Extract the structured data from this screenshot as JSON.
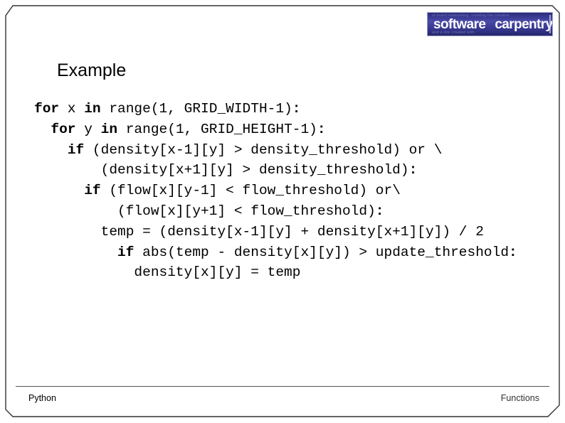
{
  "slide": {
    "title": "Example",
    "logo": {
      "word_1": "software",
      "word_2": "carpentry",
      "ghost_top": "of  insert  networking,   creating  the  creative",
      "ghost_bottom": "and  a  doc  created  with",
      "background_color": "#3a3a93",
      "text_color": "#ffffff"
    },
    "footer": {
      "left": "Python",
      "right": "Functions"
    },
    "frame": {
      "border_color": "#333333"
    }
  },
  "code": {
    "language": "python",
    "lines": [
      [
        {
          "t": "for",
          "b": true
        },
        {
          "t": " x ",
          "b": false
        },
        {
          "t": "in",
          "b": true
        },
        {
          "t": " range(1, GRID_WIDTH-1)",
          "b": false
        },
        {
          "t": ":",
          "b": true
        }
      ],
      [
        {
          "t": "  ",
          "b": false
        },
        {
          "t": "for",
          "b": true
        },
        {
          "t": " y ",
          "b": false
        },
        {
          "t": "in",
          "b": true
        },
        {
          "t": " range(1, GRID_HEIGHT-1)",
          "b": false
        },
        {
          "t": ":",
          "b": true
        }
      ],
      [
        {
          "t": "    ",
          "b": false
        },
        {
          "t": "if",
          "b": true
        },
        {
          "t": " (density[x-1][y] > density_threshold) or \\",
          "b": false
        }
      ],
      [
        {
          "t": "        (density[x+1][y] > density_threshold)",
          "b": false
        },
        {
          "t": ":",
          "b": true
        }
      ],
      [
        {
          "t": "      ",
          "b": false
        },
        {
          "t": "if",
          "b": true
        },
        {
          "t": " (flow[x][y-1] < flow_threshold) or\\",
          "b": false
        }
      ],
      [
        {
          "t": "          (flow[x][y+1] < flow_threshold)",
          "b": false
        },
        {
          "t": ":",
          "b": true
        }
      ],
      [
        {
          "t": "        temp = (density[x-1][y] + density[x+1][y]) / 2",
          "b": false
        }
      ],
      [
        {
          "t": "          ",
          "b": false
        },
        {
          "t": "if",
          "b": true
        },
        {
          "t": " abs(temp - density[x][y]) > update_threshold",
          "b": false
        },
        {
          "t": ":",
          "b": true
        }
      ],
      [
        {
          "t": "            density[x][y] = temp",
          "b": false
        }
      ]
    ]
  }
}
